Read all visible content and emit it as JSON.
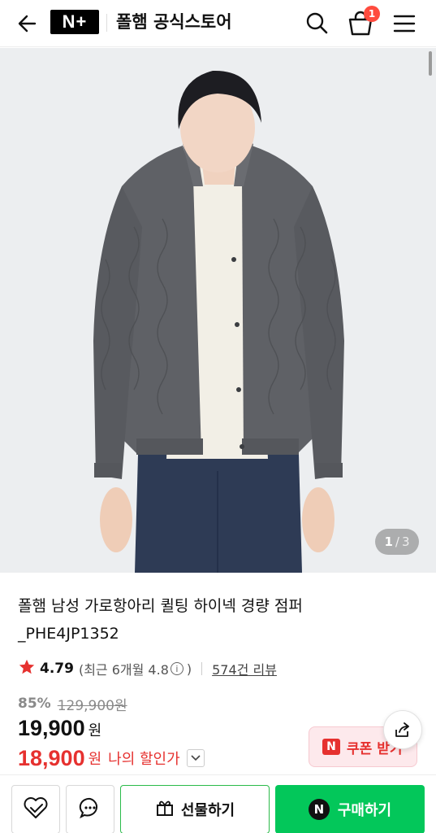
{
  "header": {
    "logo": "N+",
    "title": "폴햄 공식스토어",
    "cart_count": "1"
  },
  "gallery": {
    "current": "1",
    "separator": "/",
    "total": "3",
    "scene": {
      "background": "#eceef0",
      "jacket_color": "#5f6166",
      "inner_color": "#f2efe6",
      "jeans_color": "#2e3b55"
    }
  },
  "product": {
    "title_line1": "폴햄 남성 가로항아리 퀼팅 하이넥 경량 점퍼",
    "title_line2": "_PHE4JP1352",
    "rating": "4.79",
    "recent_label": "(최근 6개월 4.8",
    "recent_close": ")",
    "reviews": "574건 리뷰",
    "discount": "85%",
    "original_price": "129,900원",
    "price": "19,900",
    "currency": "원",
    "my_price": "18,900",
    "my_price_label": "나의 할인가"
  },
  "coupon": {
    "badge": "N",
    "label": "쿠폰 받기"
  },
  "bottom_bar": {
    "gift_label": "선물하기",
    "buy_badge": "N",
    "buy_label": "구매하기"
  },
  "colors": {
    "accent_red": "#e6312f",
    "naver_green": "#03c75a",
    "badge_red": "#ff4b3e"
  }
}
